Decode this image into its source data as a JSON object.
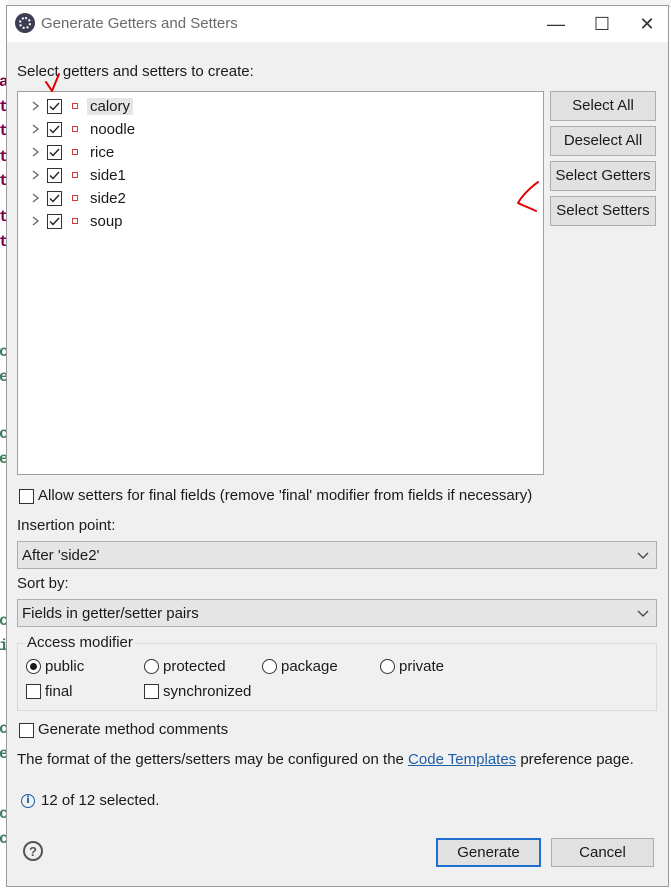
{
  "window": {
    "title": "Generate Getters and Setters",
    "controls": {
      "minimize": "—",
      "maximize": "☐",
      "close": "✕"
    }
  },
  "fields": {
    "label": "Select getters and setters to create:",
    "items": [
      {
        "name": "calory",
        "checked": true,
        "selected": true
      },
      {
        "name": "noodle",
        "checked": true,
        "selected": false
      },
      {
        "name": "rice",
        "checked": true,
        "selected": false
      },
      {
        "name": "side1",
        "checked": true,
        "selected": false
      },
      {
        "name": "side2",
        "checked": true,
        "selected": false
      },
      {
        "name": "soup",
        "checked": true,
        "selected": false
      }
    ]
  },
  "side_buttons": {
    "select_all": "Select All",
    "deselect_all": "Deselect All",
    "select_getters": "Select Getters",
    "select_setters": "Select Setters"
  },
  "allow_final": {
    "label": "Allow setters for final fields (remove 'final' modifier from fields if necessary)",
    "checked": false
  },
  "insertion_point": {
    "label": "Insertion point:",
    "value": "After 'side2'"
  },
  "sort_by": {
    "label": "Sort by:",
    "value": "Fields in getter/setter pairs"
  },
  "access_modifier": {
    "title": "Access modifier",
    "options": {
      "public": "public",
      "protected": "protected",
      "package": "package",
      "private": "private"
    },
    "selected": "public",
    "final_label": "final",
    "synchronized_label": "synchronized"
  },
  "generate_comments": {
    "label": "Generate method comments",
    "checked": false
  },
  "format_note": {
    "before": "The format of the getters/setters may be configured on the ",
    "link": "Code Templates",
    "after": " preference page."
  },
  "status": {
    "text": "12 of 12 selected."
  },
  "footer": {
    "generate": "Generate",
    "cancel": "Cancel",
    "help": "?"
  },
  "colors": {
    "annotation": "#e00000",
    "default_border": "#1f6fd1",
    "link": "#1f5fa6"
  },
  "icons": {
    "title": "eclipse-gear-icon",
    "expand": "chevron-right-icon",
    "field": "private-field-icon",
    "info": "info-icon",
    "help": "help-icon"
  }
}
